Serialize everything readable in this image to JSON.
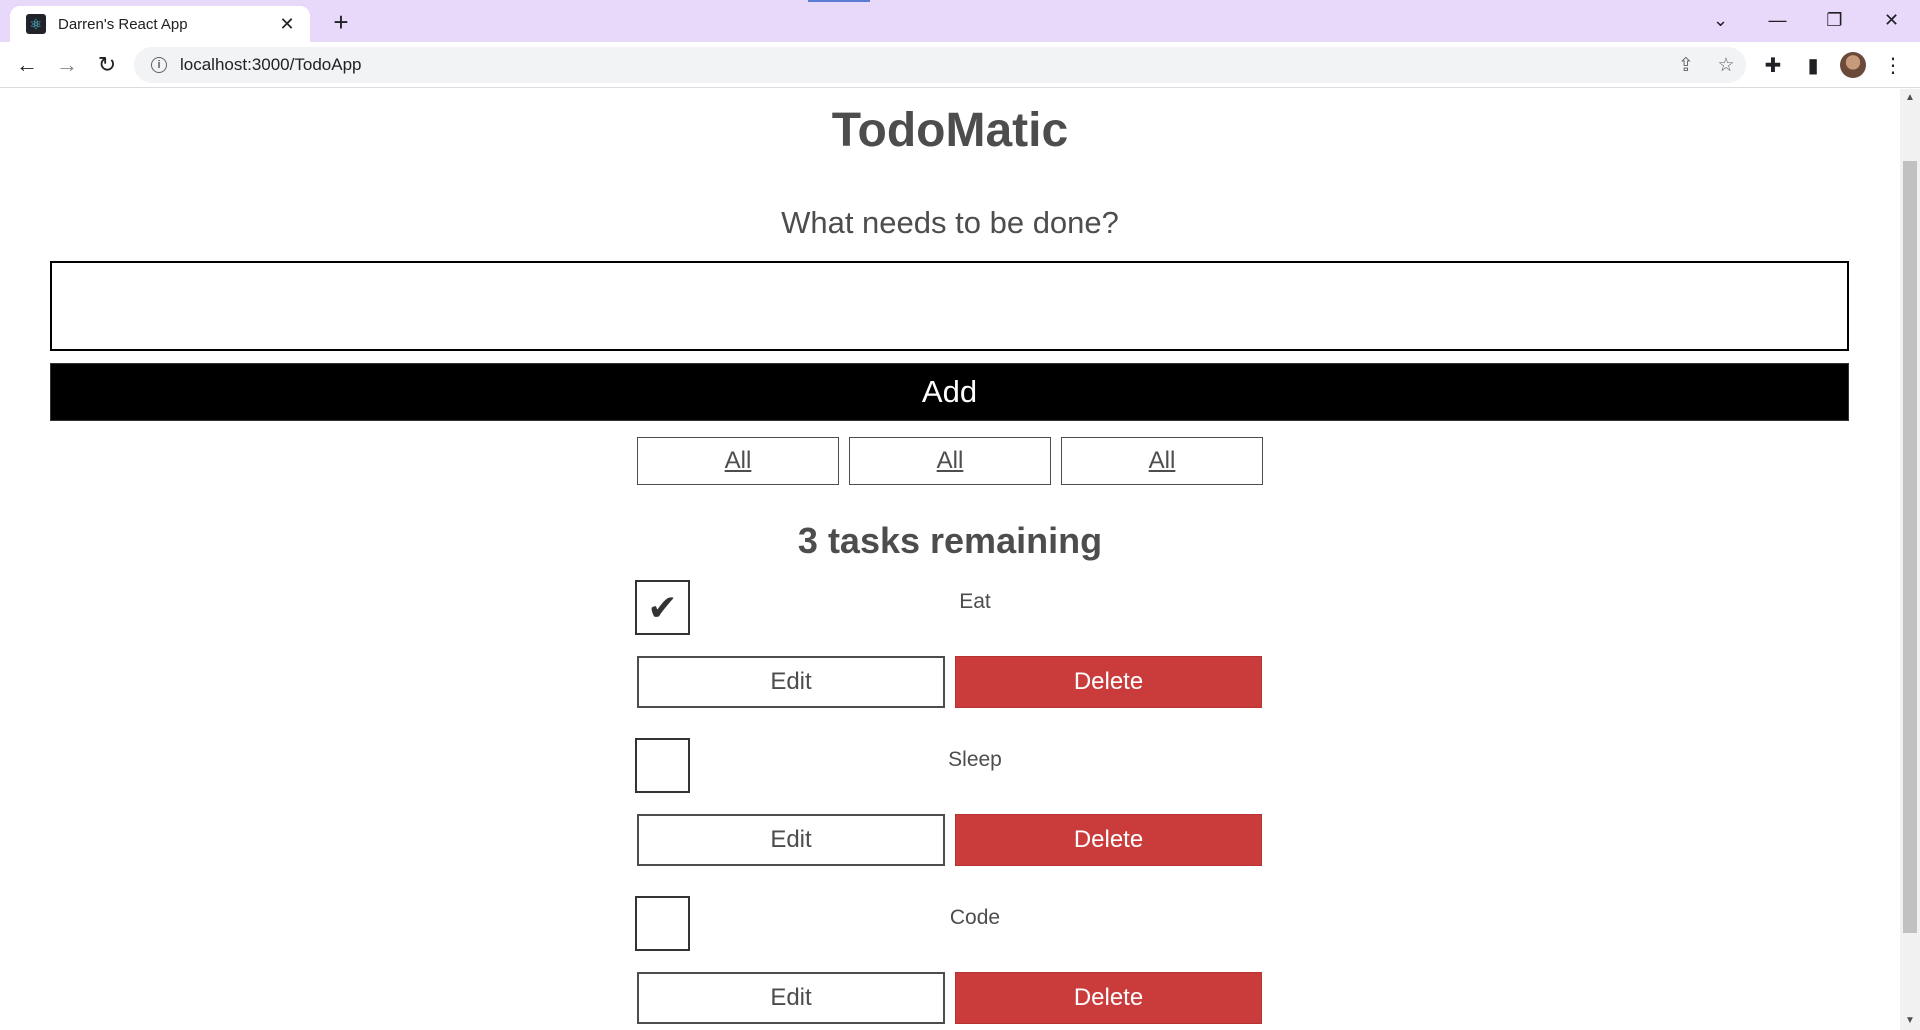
{
  "browser": {
    "tab_title": "Darren's React App",
    "url": "localhost:3000/TodoApp"
  },
  "app": {
    "title": "TodoMatic",
    "prompt": "What needs to be done?",
    "input_value": "",
    "add_label": "Add",
    "filters": [
      {
        "label": "All"
      },
      {
        "label": "All"
      },
      {
        "label": "All"
      }
    ],
    "remaining": "3 tasks remaining",
    "todos": [
      {
        "name": "Eat",
        "completed": true,
        "edit_label": "Edit",
        "delete_label": "Delete"
      },
      {
        "name": "Sleep",
        "completed": false,
        "edit_label": "Edit",
        "delete_label": "Delete"
      },
      {
        "name": "Code",
        "completed": false,
        "edit_label": "Edit",
        "delete_label": "Delete"
      }
    ]
  },
  "colors": {
    "delete": "#ca3c3c",
    "add": "#000000",
    "text": "#4d4d4d",
    "titlebar": "#e8d8fa"
  }
}
